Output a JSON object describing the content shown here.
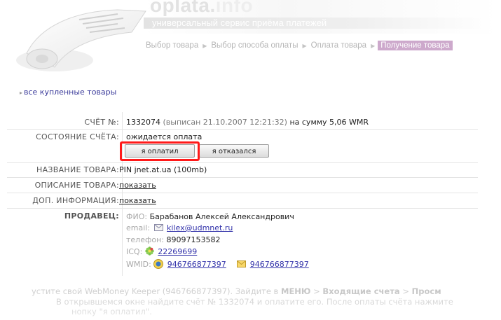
{
  "header": {
    "brand": "oplata.",
    "brand_suffix": "info",
    "tagline": "универсальный сервис приёма платежей",
    "steps": [
      {
        "label": "Выбор товара"
      },
      {
        "label": "Выбор способа оплаты"
      },
      {
        "label": "Оплата товара"
      },
      {
        "label": "Получение товара"
      }
    ],
    "active_step_color": "#cda9cc"
  },
  "back_link": "все купленные товары",
  "invoice": {
    "label": "СЧЁТ №:",
    "number": "1332074",
    "issued": "(выписан 21.10.2007 12:21:32)",
    "sum_prefix": "на сумму",
    "sum": "5,06 WMR"
  },
  "state": {
    "label": "СОСТОЯНИЕ СЧЁТА:",
    "value": "ожидается оплата",
    "paid_button": "я оплатил",
    "refused_button": "я отказался"
  },
  "product": {
    "name_label": "НАЗВАНИЕ ТОВАРА:",
    "name": "PIN jnet.at.ua (100mb)",
    "desc_label": "ОПИСАНИЕ ТОВАРА:",
    "desc_link": "показать",
    "extra_label": "ДОП. ИНФОРМАЦИЯ:",
    "extra_link": "показать"
  },
  "seller": {
    "label": "ПРОДАВЕЦ:",
    "fio_key": "ФИО:",
    "fio": "Барабанов Алексей Александрович",
    "email_key": "email:",
    "email": "kilex@udmnet.ru",
    "phone_key": "телефон:",
    "phone": "89097153582",
    "icq_key": "ICQ:",
    "icq": "22269699",
    "wmid_key": "WMID:",
    "wmid": "946766877397",
    "wmid_mail": "946766877397"
  },
  "instructions": {
    "line1_a": "устите свой WebMoney Keeper (946766877397). Зайдите в",
    "line1_menu": "МЕНЮ",
    "line1_gt": " > ",
    "line1_inbox": "Входящие счета",
    "line1_gt2": " > ",
    "line1_view": "Просм",
    "line2": "В открывшемся окне найдите счёт № 1332074 и оплатите его. После оплаты счёта нажмите",
    "line3": "нопку \"я оплатил\"."
  }
}
